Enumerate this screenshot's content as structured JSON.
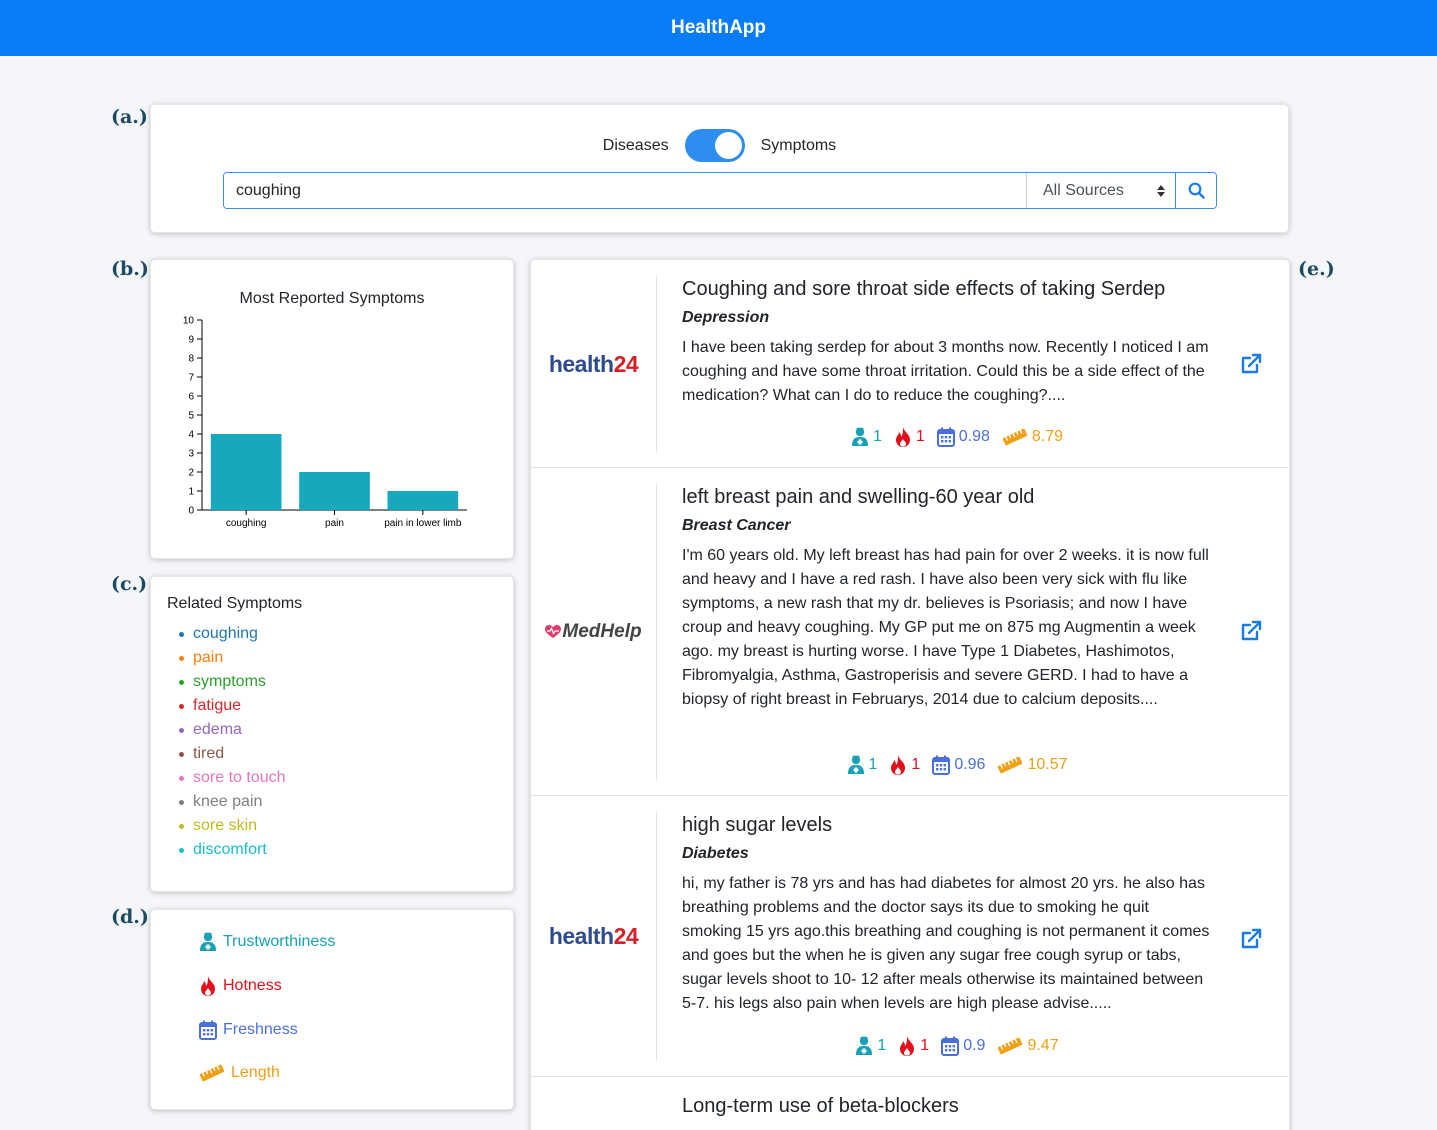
{
  "app": {
    "title": "HealthApp"
  },
  "panel_labels": {
    "a": "(a.)",
    "b": "(b.)",
    "c": "(c.)",
    "d": "(d.)",
    "e": "(e.)"
  },
  "search": {
    "toggle_left": "Diseases",
    "toggle_right": "Symptoms",
    "toggle_state": "Symptoms",
    "query": "coughing",
    "source_selected": "All Sources",
    "button_icon": "search-icon"
  },
  "chart_data": {
    "type": "bar",
    "title": "Most Reported Symptoms",
    "categories": [
      "coughing",
      "pain",
      "pain in lower limb"
    ],
    "values": [
      4,
      2,
      1
    ],
    "ylim": [
      0,
      10
    ],
    "yticks": [
      0,
      1,
      2,
      3,
      4,
      5,
      6,
      7,
      8,
      9,
      10
    ],
    "color": "#17a8bd",
    "xlabel": "",
    "ylabel": "",
    "grid": false
  },
  "related": {
    "title": "Related Symptoms",
    "items": [
      {
        "label": "coughing",
        "color": "#1f77b4"
      },
      {
        "label": "pain",
        "color": "#ff7f0e"
      },
      {
        "label": "symptoms",
        "color": "#2ca02c"
      },
      {
        "label": "fatigue",
        "color": "#d62728"
      },
      {
        "label": "edema",
        "color": "#9467bd"
      },
      {
        "label": "tired",
        "color": "#8c564b"
      },
      {
        "label": "sore to touch",
        "color": "#e377c2"
      },
      {
        "label": "knee pain",
        "color": "#7f7f7f"
      },
      {
        "label": "sore skin",
        "color": "#bcbd22"
      },
      {
        "label": "discomfort",
        "color": "#17becf"
      }
    ]
  },
  "legend": {
    "trust": {
      "label": "Trustworthiness",
      "icon": "doctor-icon",
      "color": "#17a2b8"
    },
    "hot": {
      "label": "Hotness",
      "icon": "fire-icon",
      "color": "#e3101c"
    },
    "fresh": {
      "label": "Freshness",
      "icon": "calendar-icon",
      "color": "#4a6fdc"
    },
    "length": {
      "label": "Length",
      "icon": "ruler-icon",
      "color": "#f0a014"
    }
  },
  "results": [
    {
      "source": "health24",
      "title": "Coughing and sore throat side effects of taking Serdep",
      "category": "Depression",
      "body": "I have been taking serdep for about 3 months now. Recently I noticed I am coughing and have some throat irritation. Could this be a side effect of the medication? What can I do to reduce the coughing?....",
      "trust": "1",
      "hot": "1",
      "fresh": "0.98",
      "length": "8.79"
    },
    {
      "source": "MedHelp",
      "title": "left breast pain and swelling-60 year old",
      "category": "Breast Cancer",
      "body": "I'm 60 years old.  My left breast has had pain for over 2 weeks.  it is now full and heavy and I have a red rash.  I have also been very sick with flu like symptoms, a new rash that my dr. believes is Psoriasis; and now I have croup and heavy coughing.  My GP put me on 875 mg Augmentin a week ago.  my breast is hurting worse.  I have Type 1 Diabetes, Hashimotos, Fibromyalgia, Asthma, Gastroperisis and severe GERD.  I had to have a biopsy of right breast in Februarys, 2014 due to calcium deposits....",
      "trust": "1",
      "hot": "1",
      "fresh": "0.96",
      "length": "10.57"
    },
    {
      "source": "health24",
      "title": "high sugar levels",
      "category": "Diabetes",
      "body": "hi, my father is 78 yrs and has had diabetes for almost 20 yrs. he also has breathing problems and the doctor says its due to smoking he quit smoking 15 yrs ago.this breathing and coughing is not permanent it comes and goes but the when he is given any sugar free cough syrup or tabs, sugar levels shoot to 10- 12 after meals otherwise its maintained between 5-7. his legs also pain when levels are high please advise.....",
      "trust": "1",
      "hot": "1",
      "fresh": "0.9",
      "length": "9.47"
    },
    {
      "source": "",
      "title": "Long-term use of beta-blockers",
      "category": "",
      "body": "",
      "trust": "",
      "hot": "",
      "fresh": "",
      "length": ""
    }
  ]
}
